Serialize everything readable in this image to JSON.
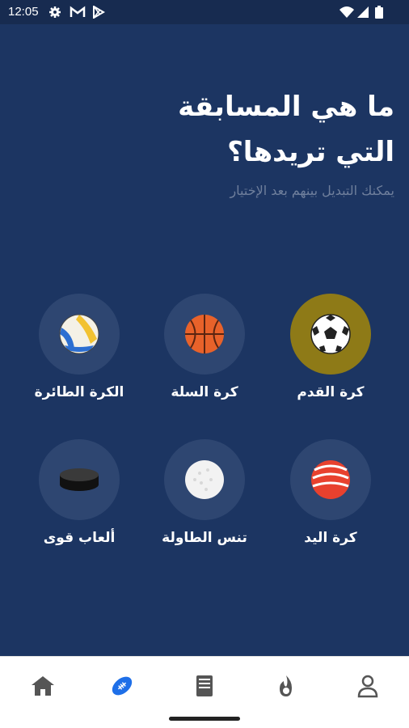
{
  "status_bar": {
    "time": "12:05",
    "left_icons": [
      "gear-icon",
      "gmail-icon",
      "play-store-icon"
    ],
    "right_icons": [
      "wifi-icon",
      "signal-icon",
      "battery-icon"
    ]
  },
  "header": {
    "title_line1": "ما هي المسابقة",
    "title_line2": "التي تريدها؟",
    "subtitle": "يمكنك التبديل بينهم بعد الإختيار"
  },
  "sports": [
    {
      "label": "كرة القدم",
      "icon": "soccer-ball-icon",
      "selected": true
    },
    {
      "label": "كرة السلة",
      "icon": "basketball-icon",
      "selected": false
    },
    {
      "label": "الكرة الطائرة",
      "icon": "volleyball-icon",
      "selected": false
    },
    {
      "label": "كرة اليد",
      "icon": "handball-icon",
      "selected": false
    },
    {
      "label": "تنس الطاولة",
      "icon": "table-tennis-ball-icon",
      "selected": false
    },
    {
      "label": "ألعاب قوى",
      "icon": "puck-icon",
      "selected": false
    }
  ],
  "bottom_nav": {
    "items": [
      "home-icon",
      "football-icon",
      "book-icon",
      "fire-icon",
      "profile-icon"
    ],
    "active": "football-icon",
    "active_color": "#1e6fe8",
    "inactive_color": "#555555"
  },
  "colors": {
    "background": "#1c3562",
    "circle": "#2e4671",
    "selected_circle": "#8e7a17"
  }
}
